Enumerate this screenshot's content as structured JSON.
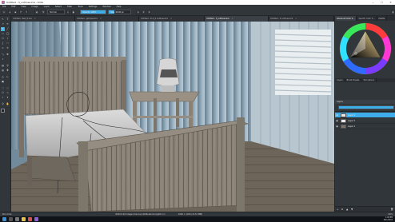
{
  "window": {
    "title": "Untitled - 3_outlines.kra - Krita",
    "minimize": "—",
    "maximize": "☐",
    "close": "✕"
  },
  "menu": [
    "File",
    "Edit",
    "View",
    "Image",
    "Layer",
    "Select",
    "Filter",
    "Tools",
    "Settings",
    "Window",
    "Help"
  ],
  "tool_options": {
    "blend_mode": "Normal",
    "opacity_label": "Opacity: 100%",
    "opacity": 1.0,
    "size_label": "Size: 90.00 px",
    "size_fill": 0.25
  },
  "tabs": [
    {
      "label": "Untitled - Bed_5.kra",
      "active": false
    },
    {
      "label": "Untitled - glimpse.kra",
      "active": false
    },
    {
      "label": "Untitled - 2nd_2 outlines.kra",
      "active": false
    },
    {
      "label": "Untitled - 3_outlines.kra",
      "active": true
    },
    {
      "label": "Untitled - 4 outlines.kra",
      "active": false
    }
  ],
  "close_glyph": "×",
  "dock": {
    "top_tabs": [
      "Advanced Color S...",
      "Specific Color S...",
      "Palette"
    ],
    "sub_tabs": [
      "Layers",
      "Brush Presets",
      "Tool options"
    ],
    "layers_header": "Layers",
    "layers": [
      {
        "name": "Layer 4",
        "selected": true
      },
      {
        "name": "Layer 3",
        "selected": false
      },
      {
        "name": "Layer 1",
        "selected": false
      }
    ]
  },
  "status": {
    "left": "Pen circle",
    "center": "RGB (8-bit integer/channel)  sRGB-elle-V2-srgbtrc.icc",
    "right": "1600 × 1200 (13.51 MiB)",
    "zoom": "60%"
  },
  "clock": {
    "time": "1:06 PM",
    "date": "6/21/2019"
  },
  "colors": {
    "accent": "#3daee9",
    "panel": "#31363b",
    "taskbar": "#101418"
  }
}
